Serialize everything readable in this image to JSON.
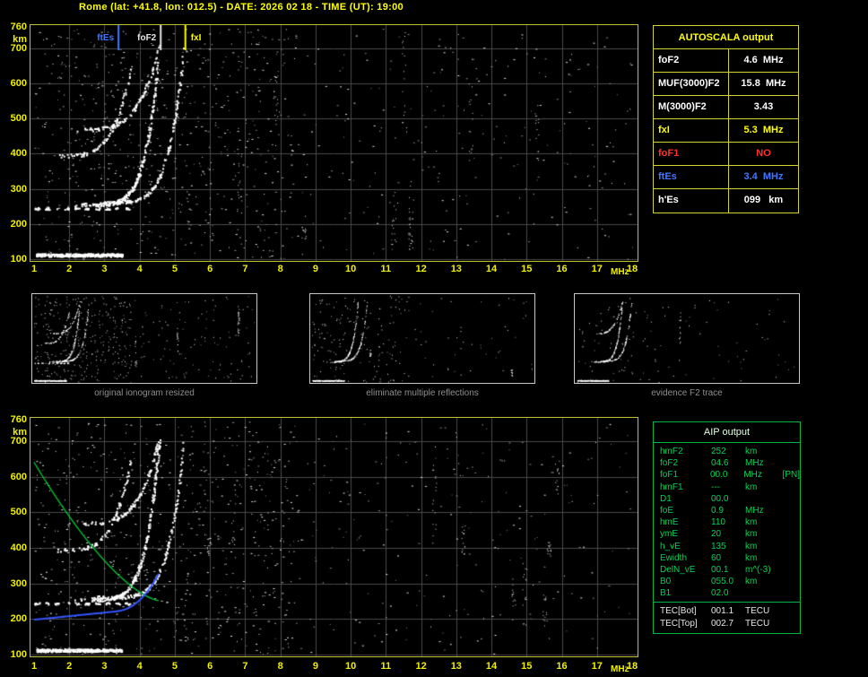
{
  "header": {
    "title": "Rome (lat: +41.8, lon: 012.5) - DATE: 2026 02 18 - TIME (UT): 19:00"
  },
  "autoscala_table": {
    "title": "AUTOSCALA output",
    "rows": [
      {
        "label": "foF2",
        "value": "4.6  MHz",
        "color": "#ffffff"
      },
      {
        "label": "MUF(3000)F2",
        "value": "15.8  MHz",
        "color": "#ffffff"
      },
      {
        "label": "M(3000)F2",
        "value": "3.43",
        "color": "#ffffff"
      },
      {
        "label": "fxI",
        "value": "5.3  MHz",
        "color": "#ffff00"
      },
      {
        "label": "foF1",
        "value": "NO",
        "color": "#ff3030"
      },
      {
        "label": "ftEs",
        "value": "3.4  MHz",
        "color": "#4477ff"
      },
      {
        "label": "h'Es",
        "value": "099   km",
        "color": "#ffffff"
      }
    ]
  },
  "aip_table": {
    "title": "AIP output",
    "rows": [
      {
        "name": "hmF2",
        "value": "252",
        "unit": "km",
        "extra": ""
      },
      {
        "name": "foF2",
        "value": "04.6",
        "unit": "MHz",
        "extra": ""
      },
      {
        "name": "foF1",
        "value": "00.0",
        "unit": "MHz",
        "extra": "[PN]"
      },
      {
        "name": "hmF1",
        "value": "---",
        "unit": "km",
        "extra": ""
      },
      {
        "name": "D1",
        "value": "00.0",
        "unit": "",
        "extra": ""
      },
      {
        "name": "foE",
        "value": "0.9",
        "unit": "MHz",
        "extra": ""
      },
      {
        "name": "hmE",
        "value": "110",
        "unit": "km",
        "extra": ""
      },
      {
        "name": "ymE",
        "value": "20",
        "unit": "km",
        "extra": ""
      },
      {
        "name": "h_vE",
        "value": "135",
        "unit": "km",
        "extra": ""
      },
      {
        "name": "Ewidth",
        "value": "60",
        "unit": "km",
        "extra": ""
      },
      {
        "name": "DelN_vE",
        "value": "00.1",
        "unit": "m^(-3)",
        "extra": ""
      },
      {
        "name": "B0",
        "value": "055.0",
        "unit": "km",
        "extra": ""
      },
      {
        "name": "B1",
        "value": "02.0",
        "unit": "",
        "extra": ""
      }
    ],
    "tec_rows": [
      {
        "name": "TEC[Bot]",
        "value": "001.1",
        "unit": "TECU",
        "extra": ""
      },
      {
        "name": "TEC[Top]",
        "value": "002.7",
        "unit": "TECU",
        "extra": ""
      }
    ]
  },
  "thumbnails": [
    {
      "caption": "original ionogram resized"
    },
    {
      "caption": "eliminate multiple reflections"
    },
    {
      "caption": "evidence F2 trace"
    }
  ],
  "chart_data": {
    "type": "scatter",
    "title": "Ionogram (virtual height vs sounding frequency)",
    "x_axis": {
      "unit": "MHz",
      "range": [
        1,
        18
      ],
      "ticks": [
        1,
        2,
        3,
        4,
        5,
        6,
        7,
        8,
        9,
        10,
        11,
        12,
        13,
        14,
        15,
        16,
        17,
        18
      ]
    },
    "y_axis": {
      "unit": "km",
      "range": [
        100,
        760
      ],
      "ticks": [
        760,
        700,
        600,
        500,
        400,
        300,
        200,
        100
      ]
    },
    "grid_color": "#4a4a4a",
    "dot_color": "#ffffff",
    "markers": [
      {
        "label": "ftEs",
        "freq_mhz": 3.4,
        "color": "#4477ff"
      },
      {
        "label": "foF2",
        "freq_mhz": 4.6,
        "color": "#e8e8e8"
      },
      {
        "label": "fxI",
        "freq_mhz": 5.3,
        "color": "#ffff00"
      }
    ],
    "traces": [
      {
        "name": "Es-layer",
        "f_min": 1.05,
        "f_max": 3.5,
        "h_km": 113,
        "h_jitter": 4,
        "n": 320
      },
      {
        "name": "Es-second-reflection",
        "f_min": 1.0,
        "f_max": 3.85,
        "h_km": 245,
        "h_jitter": 3,
        "n": 130,
        "gappy": true
      },
      {
        "name": "F2-ordinary",
        "f0": 2.05,
        "f_span": 2.5,
        "h0": 256,
        "h_span": 446,
        "pf": 0.5,
        "ph": 3.1,
        "n": 230
      },
      {
        "name": "F2-extraordinary",
        "f0": 2.5,
        "f_span": 2.75,
        "h0": 262,
        "h_span": 440,
        "pf": 0.5,
        "ph": 3.1,
        "n": 150
      },
      {
        "name": "F2-second-hop-a",
        "f0": 2.2,
        "f_span": 2.35,
        "h0": 470,
        "h_span": 240,
        "pf": 0.6,
        "ph": 2.4,
        "n": 100
      },
      {
        "name": "F2-second-hop-b",
        "f0": 1.65,
        "f_span": 2.1,
        "h0": 395,
        "h_span": 255,
        "pf": 0.6,
        "ph": 2.4,
        "n": 80
      }
    ],
    "noise": {
      "uniform": 430,
      "left_half": 520,
      "streaks": 9
    },
    "profile": {
      "hmF2_km": 252,
      "foF2_mhz": 4.55,
      "topside_color": "#00cc33",
      "bottomside_color": "#3355ff",
      "topside_start": {
        "freq_mhz": 1.0,
        "h_km": 640
      },
      "bottomside_start": {
        "freq_mhz": 1.0,
        "h_km": 198
      }
    }
  }
}
